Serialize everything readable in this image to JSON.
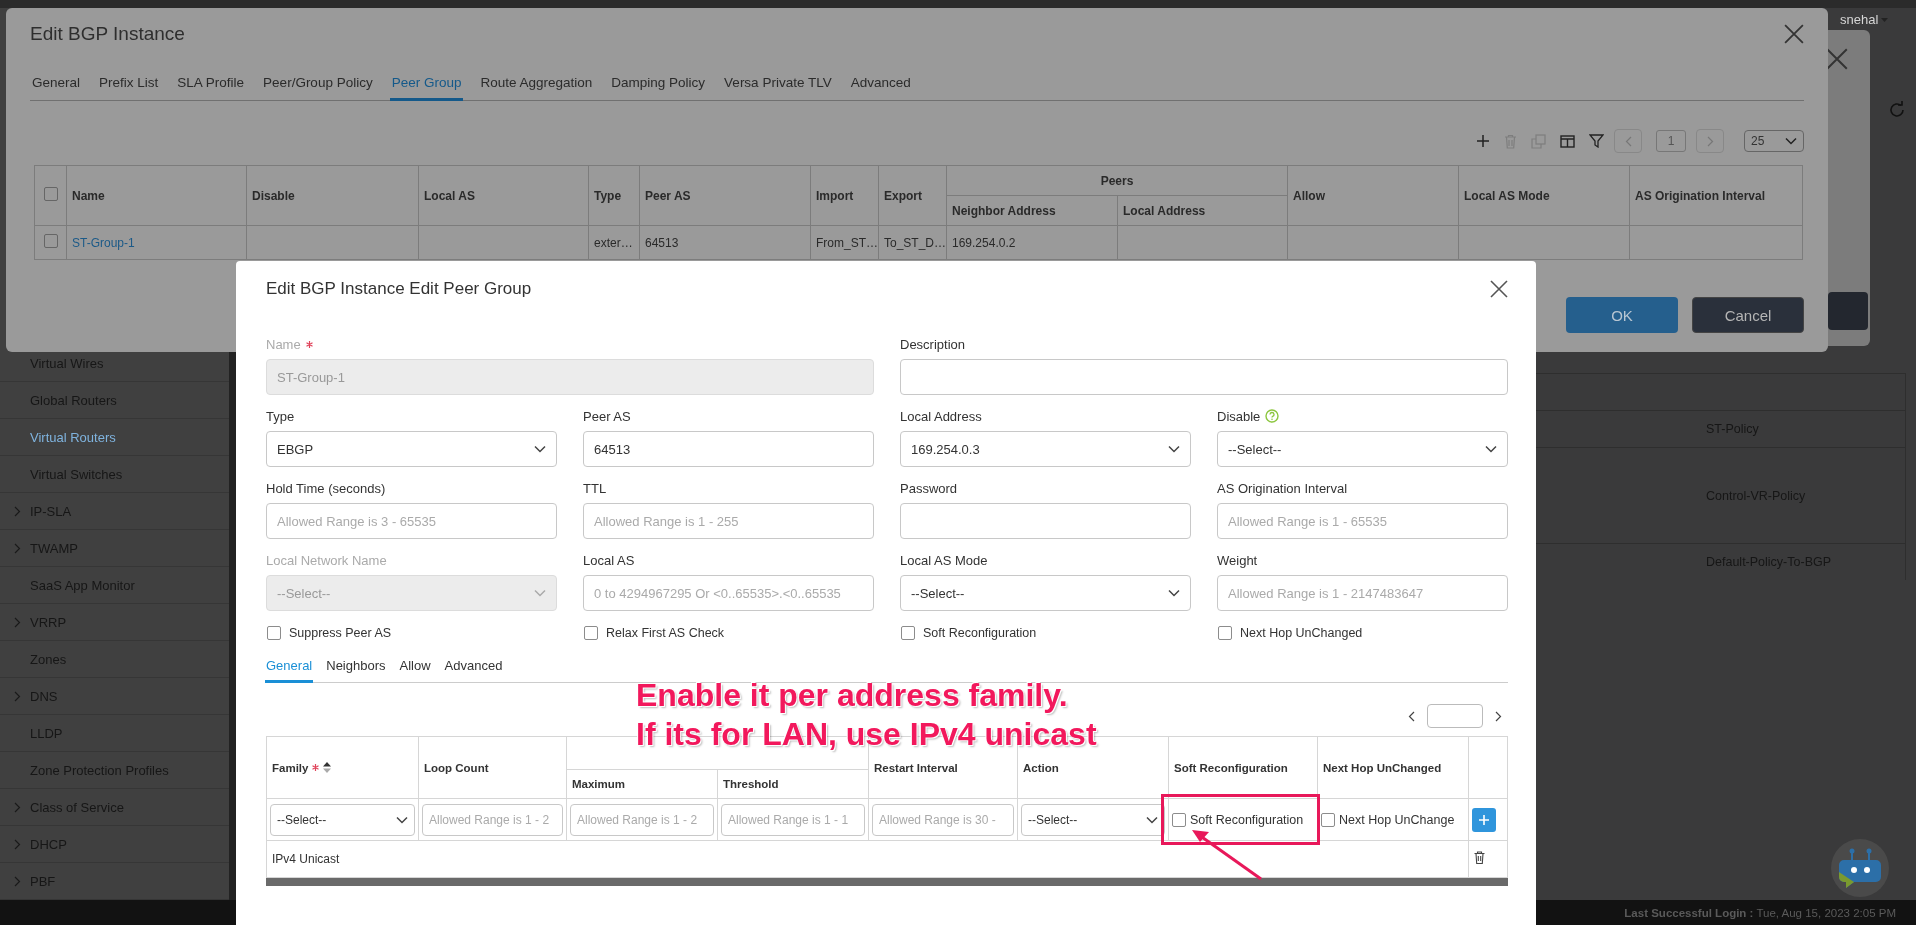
{
  "user_menu": {
    "label": "snehal"
  },
  "sidebar": {
    "items": [
      {
        "label": "Virtual Wires",
        "selected": false,
        "expandable": false
      },
      {
        "label": "Global Routers",
        "selected": false,
        "expandable": false
      },
      {
        "label": "Virtual Routers",
        "selected": true,
        "expandable": false
      },
      {
        "label": "Virtual Switches",
        "selected": false,
        "expandable": false
      },
      {
        "label": "IP-SLA",
        "selected": false,
        "expandable": true
      },
      {
        "label": "TWAMP",
        "selected": false,
        "expandable": true
      },
      {
        "label": "SaaS App Monitor",
        "selected": false,
        "expandable": false
      },
      {
        "label": "VRRP",
        "selected": false,
        "expandable": true
      },
      {
        "label": "Zones",
        "selected": false,
        "expandable": false
      },
      {
        "label": "DNS",
        "selected": false,
        "expandable": true
      },
      {
        "label": "LLDP",
        "selected": false,
        "expandable": false
      },
      {
        "label": "Zone Protection Profiles",
        "selected": false,
        "expandable": false
      },
      {
        "label": "Class of Service",
        "selected": false,
        "expandable": true
      },
      {
        "label": "DHCP",
        "selected": false,
        "expandable": true
      },
      {
        "label": "PBF",
        "selected": false,
        "expandable": true
      }
    ]
  },
  "background_table": {
    "rows": [
      {
        "policy": "ST-Policy"
      },
      {
        "policy": "Control-VR-Policy"
      },
      {
        "policy": "Default-Policy-To-BGP"
      }
    ]
  },
  "footer": {
    "login": "**Last Successful Login :** Tue, Aug 15, 2023 2:05 PM"
  },
  "bgp_dialog": {
    "title": "Edit BGP Instance",
    "tabs": [
      {
        "label": "General",
        "selected": false
      },
      {
        "label": "Prefix List",
        "selected": false
      },
      {
        "label": "SLA Profile",
        "selected": false
      },
      {
        "label": "Peer/Group Policy",
        "selected": false
      },
      {
        "label": "Peer Group",
        "selected": true
      },
      {
        "label": "Route Aggregation",
        "selected": false
      },
      {
        "label": "Damping Policy",
        "selected": false
      },
      {
        "label": "Versa Private TLV",
        "selected": false
      },
      {
        "label": "Advanced",
        "selected": false
      }
    ],
    "toolbar": [
      {
        "kind": "add",
        "disabled": false
      },
      {
        "kind": "delete",
        "disabled": true
      },
      {
        "kind": "copy",
        "disabled": true
      },
      {
        "kind": "columns",
        "disabled": false
      },
      {
        "kind": "filter",
        "disabled": false
      }
    ],
    "pager": {
      "page": "1",
      "page_size": "25"
    },
    "table": {
      "select_all": {
        "checked": false
      },
      "columns": [
        {
          "label": "Name"
        },
        {
          "label": "Disable"
        },
        {
          "label": "Local AS"
        },
        {
          "label": "Type"
        },
        {
          "label": "Peer AS"
        },
        {
          "label": "Import"
        },
        {
          "label": "Export"
        },
        {
          "label": "Peers",
          "children": [
            {
              "label": "Neighbor Address"
            },
            {
              "label": "Local Address"
            }
          ]
        },
        {
          "label": "Allow"
        },
        {
          "label": "Local AS Mode"
        },
        {
          "label": "AS Origination Interval"
        }
      ],
      "rows": [
        {
          "checked": false,
          "name": "ST-Group-1",
          "type": "exter…",
          "peer_as": "64513",
          "import": "From_ST…",
          "export": "To_ST_D…",
          "neighbor_address": "169.254.0.2"
        }
      ]
    },
    "buttons": [
      {
        "label": "OK",
        "kind": "primary"
      },
      {
        "label": "Cancel",
        "kind": "secondary"
      }
    ]
  },
  "peer_group_dialog": {
    "title": "Edit BGP Instance Edit Peer Group",
    "fields": [
      {
        "label": "Name",
        "kind": "text",
        "value": "ST-Group-1",
        "required": true,
        "disabled": true,
        "help": false,
        "wide": true
      },
      {
        "label": "Description",
        "kind": "text",
        "required": false,
        "disabled": false,
        "help": false,
        "wide": true
      },
      {
        "label": "Type",
        "kind": "select",
        "value": "EBGP",
        "required": false,
        "disabled": false,
        "help": false,
        "wide": false
      },
      {
        "label": "Peer AS",
        "kind": "text",
        "value": "64513",
        "required": false,
        "disabled": false,
        "help": false,
        "wide": false
      },
      {
        "label": "Local Address",
        "kind": "select",
        "value": "169.254.0.3",
        "required": false,
        "disabled": false,
        "help": false,
        "wide": false
      },
      {
        "label": "Disable",
        "kind": "select",
        "value": "--Select--",
        "required": false,
        "disabled": false,
        "help": true,
        "wide": false
      },
      {
        "label": "Hold Time (seconds)",
        "kind": "text",
        "placeholder": "Allowed Range is 3 - 65535",
        "required": false,
        "disabled": false,
        "help": false,
        "wide": false
      },
      {
        "label": "TTL",
        "kind": "text",
        "placeholder": "Allowed Range is 1 - 255",
        "required": false,
        "disabled": false,
        "help": false,
        "wide": false
      },
      {
        "label": "Password",
        "kind": "text",
        "required": false,
        "disabled": false,
        "help": false,
        "wide": false
      },
      {
        "label": "AS Origination Interval",
        "kind": "text",
        "placeholder": "Allowed Range is 1 - 65535",
        "required": false,
        "disabled": false,
        "help": false,
        "wide": false
      },
      {
        "label": "Local Network Name",
        "kind": "select",
        "value": "--Select--",
        "required": false,
        "disabled": true,
        "help": false,
        "wide": false
      },
      {
        "label": "Local AS",
        "kind": "text",
        "placeholder": "0 to 4294967295 Or <0..65535>.<0..65535",
        "required": false,
        "disabled": false,
        "help": false,
        "wide": false
      },
      {
        "label": "Local AS Mode",
        "kind": "select",
        "value": "--Select--",
        "required": false,
        "disabled": false,
        "help": false,
        "wide": false
      },
      {
        "label": "Weight",
        "kind": "text",
        "placeholder": "Allowed Range is 1 - 2147483647",
        "required": false,
        "disabled": false,
        "help": false,
        "wide": false
      }
    ],
    "checkboxes": [
      {
        "label": "Suppress Peer AS",
        "checked": false
      },
      {
        "label": "Relax First AS Check",
        "checked": false
      },
      {
        "label": "Soft Reconfiguration",
        "checked": false
      },
      {
        "label": "Next Hop UnChanged",
        "checked": false
      }
    ],
    "subtabs": [
      {
        "label": "General",
        "selected": true
      },
      {
        "label": "Neighbors",
        "selected": false
      },
      {
        "label": "Allow",
        "selected": false
      },
      {
        "label": "Advanced",
        "selected": false
      }
    ],
    "family_table": {
      "columns": [
        {
          "kind": "field",
          "label": "Family",
          "required": true,
          "sortable": true
        },
        {
          "kind": "field",
          "label": "Loop Count",
          "required": false,
          "sortable": false
        },
        {
          "kind": "group",
          "children": [
            {
              "label": "Maximum"
            },
            {
              "label": "Threshold"
            }
          ]
        },
        {
          "kind": "field",
          "label": "Restart Interval",
          "required": false,
          "sortable": false
        },
        {
          "kind": "field",
          "label": "Action",
          "required": false,
          "sortable": false
        },
        {
          "kind": "field",
          "label": "Soft Reconfiguration",
          "required": false,
          "sortable": false
        },
        {
          "kind": "field",
          "label": "Next Hop UnChanged",
          "required": false,
          "sortable": false
        },
        {
          "kind": "actions"
        }
      ],
      "input_row": [
        {
          "kind": "select",
          "value": "--Select--"
        },
        {
          "kind": "text",
          "placeholder": "Allowed Range is 1 - 2"
        },
        {
          "kind": "text",
          "placeholder": "Allowed Range is 1 - 2"
        },
        {
          "kind": "text",
          "placeholder": "Allowed Range is 1 - 1"
        },
        {
          "kind": "text",
          "placeholder": "Allowed Range is 30 -"
        },
        {
          "kind": "select",
          "value": "--Select--"
        },
        {
          "kind": "checkbox",
          "label": "Soft Reconfiguration",
          "checked": false,
          "highlighted": true
        },
        {
          "kind": "checkbox",
          "label": "Next Hop UnChange",
          "checked": false,
          "highlighted": false
        },
        {
          "kind": "add"
        }
      ],
      "rows": [
        {
          "family": "IPv4 Unicast"
        }
      ]
    }
  },
  "annotation": {
    "lines": [
      "Enable it per address family.",
      "If its for LAN, use IPv4 unicast"
    ]
  }
}
